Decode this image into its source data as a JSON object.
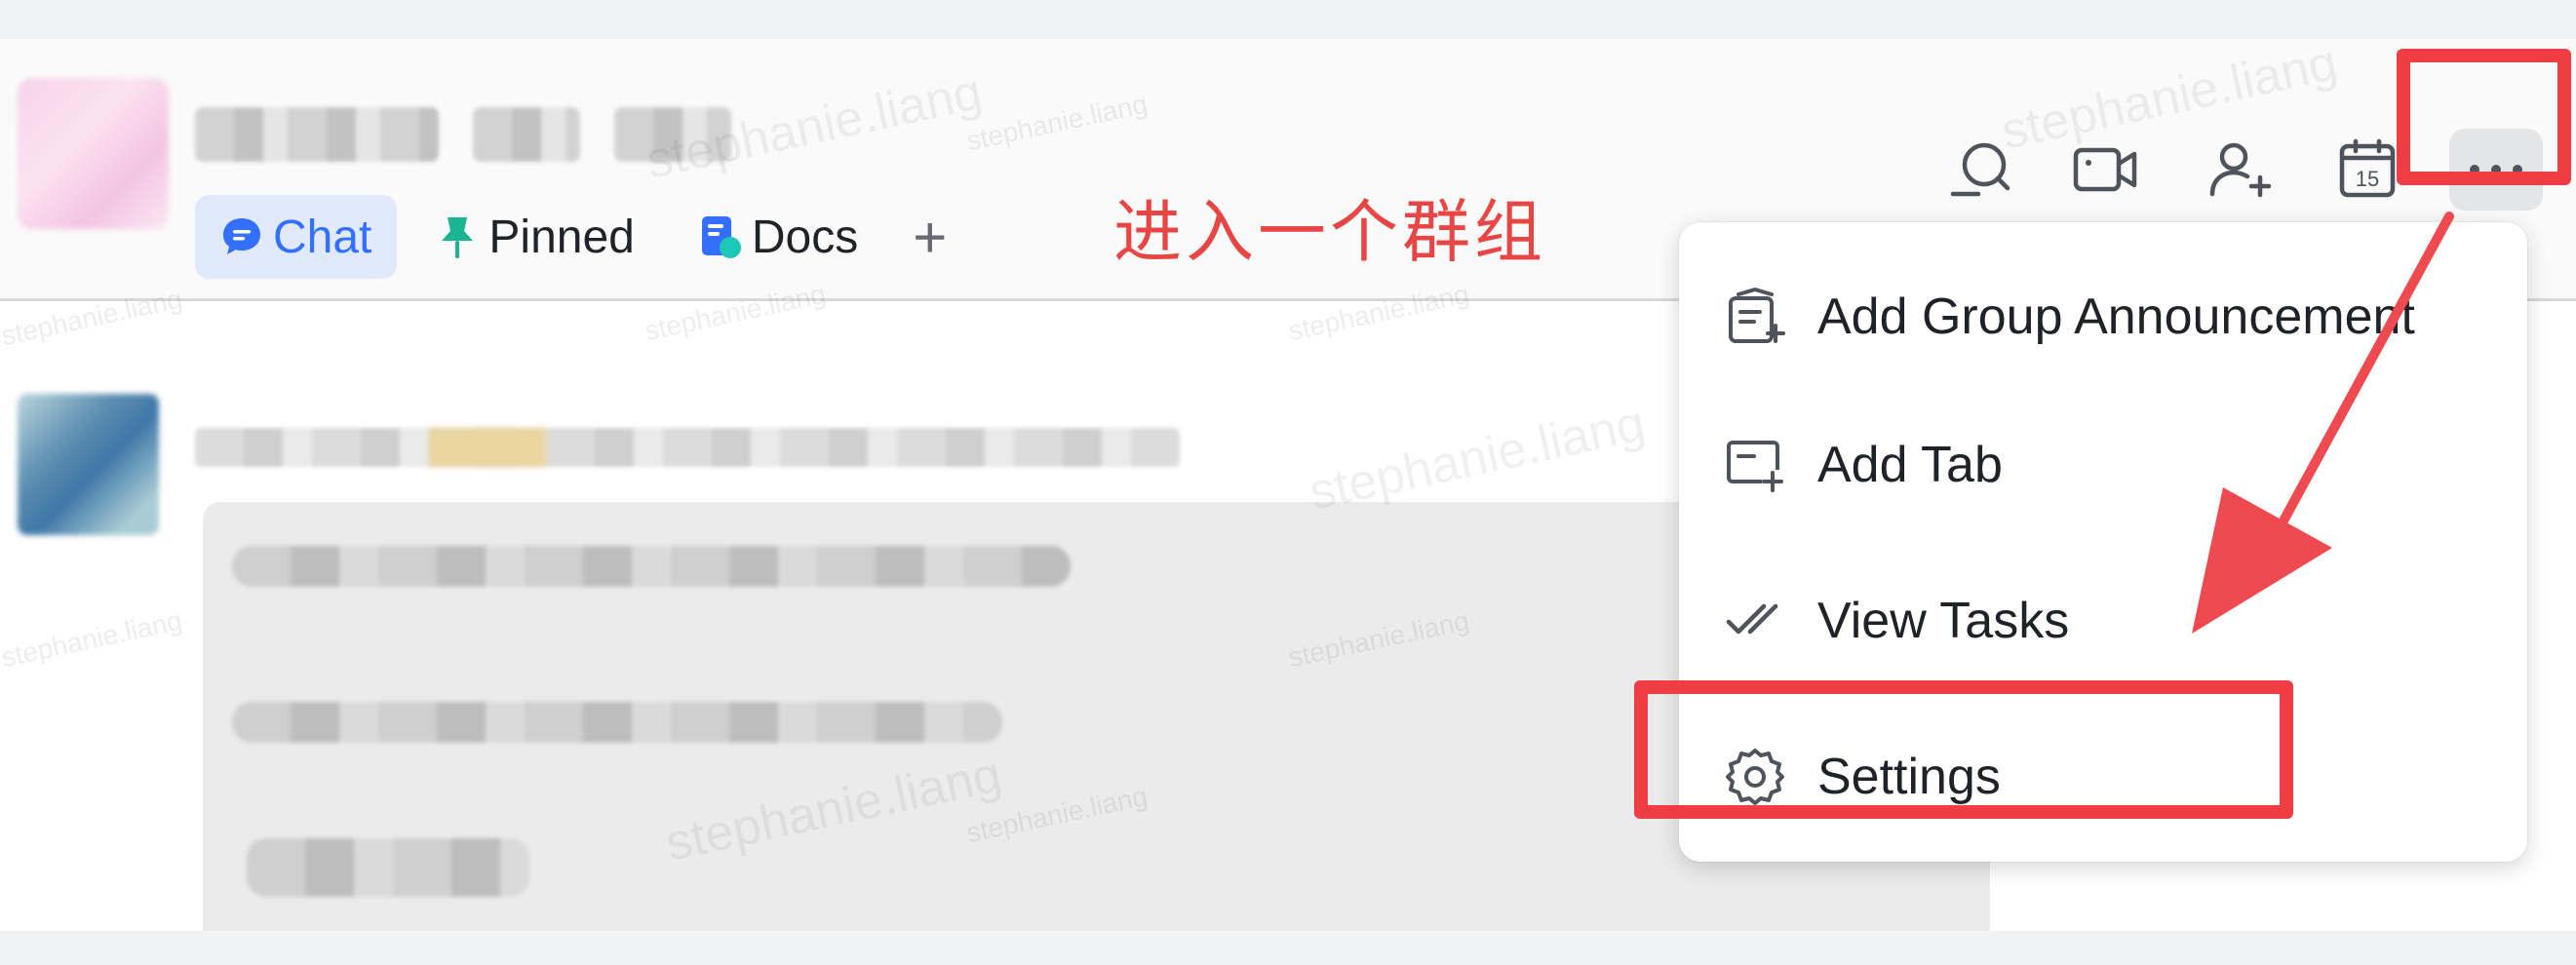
{
  "header": {
    "tabs": [
      {
        "label": "Chat",
        "icon": "chat-bubble-icon",
        "active": true
      },
      {
        "label": "Pinned",
        "icon": "pin-icon",
        "active": false
      },
      {
        "label": "Docs",
        "icon": "docs-icon",
        "active": false
      }
    ],
    "add_tab_symbol": "+",
    "toolbar_icons": [
      "search-icon",
      "video-call-icon",
      "add-member-icon",
      "calendar-icon",
      "more-icon"
    ],
    "calendar_day": "15"
  },
  "annotation": {
    "text": "进入一个群组",
    "color": "#e84545"
  },
  "menu": {
    "items": [
      {
        "label": "Add Group Announcement",
        "icon": "announcement-icon"
      },
      {
        "label": "Add Tab",
        "icon": "add-tab-icon"
      },
      {
        "label": "View Tasks",
        "icon": "tasks-check-icon"
      },
      {
        "label": "Settings",
        "icon": "gear-icon"
      }
    ]
  },
  "watermark": "stephanie.liang",
  "colors": {
    "accent": "#3370ff",
    "active_tab_bg": "#e1e9fc",
    "highlight_red": "#ef3e43",
    "pin_green": "#1cb593"
  }
}
